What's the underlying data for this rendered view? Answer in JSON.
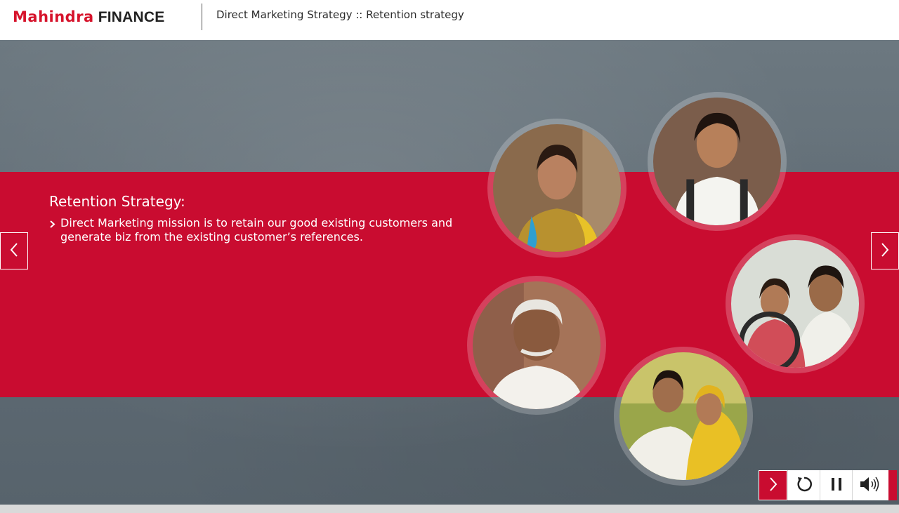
{
  "header": {
    "logo_brand": "Mahindra",
    "logo_suffix": "FINANCE",
    "title": "Direct Marketing Strategy :: Retention strategy"
  },
  "slide": {
    "heading": "Retention Strategy:",
    "bullets": [
      "Direct Marketing mission is to retain our good existing customers and generate biz from the existing customer’s references."
    ]
  },
  "icons": {
    "prev": "chevron-left-icon",
    "next": "chevron-right-icon",
    "bullet": "chevron-right-icon",
    "replay": "replay-icon",
    "pause": "pause-icon",
    "volume": "volume-icon"
  },
  "colors": {
    "brand_red": "#c90c30",
    "background_gray": "#606c75",
    "text_white": "#ffffff"
  }
}
